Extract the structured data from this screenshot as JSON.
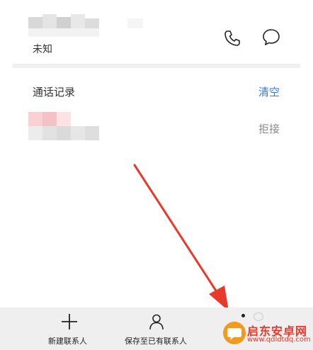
{
  "contact": {
    "subtitle": "未知"
  },
  "call_log": {
    "title": "通话记录",
    "clear_label": "清空",
    "entries": [
      {
        "status": "拒接"
      }
    ]
  },
  "bottom_bar": {
    "new_contact_label": "新建联系人",
    "save_existing_label": "保存至已有联系人"
  },
  "watermark": {
    "name": "启东安卓网",
    "url": "www.qdldtdq.com"
  },
  "colors": {
    "accent_blue": "#2a7de1",
    "arrow_red": "#e8392b",
    "divider": "#f0f0f0",
    "bottom_bar_bg": "#efefef"
  }
}
